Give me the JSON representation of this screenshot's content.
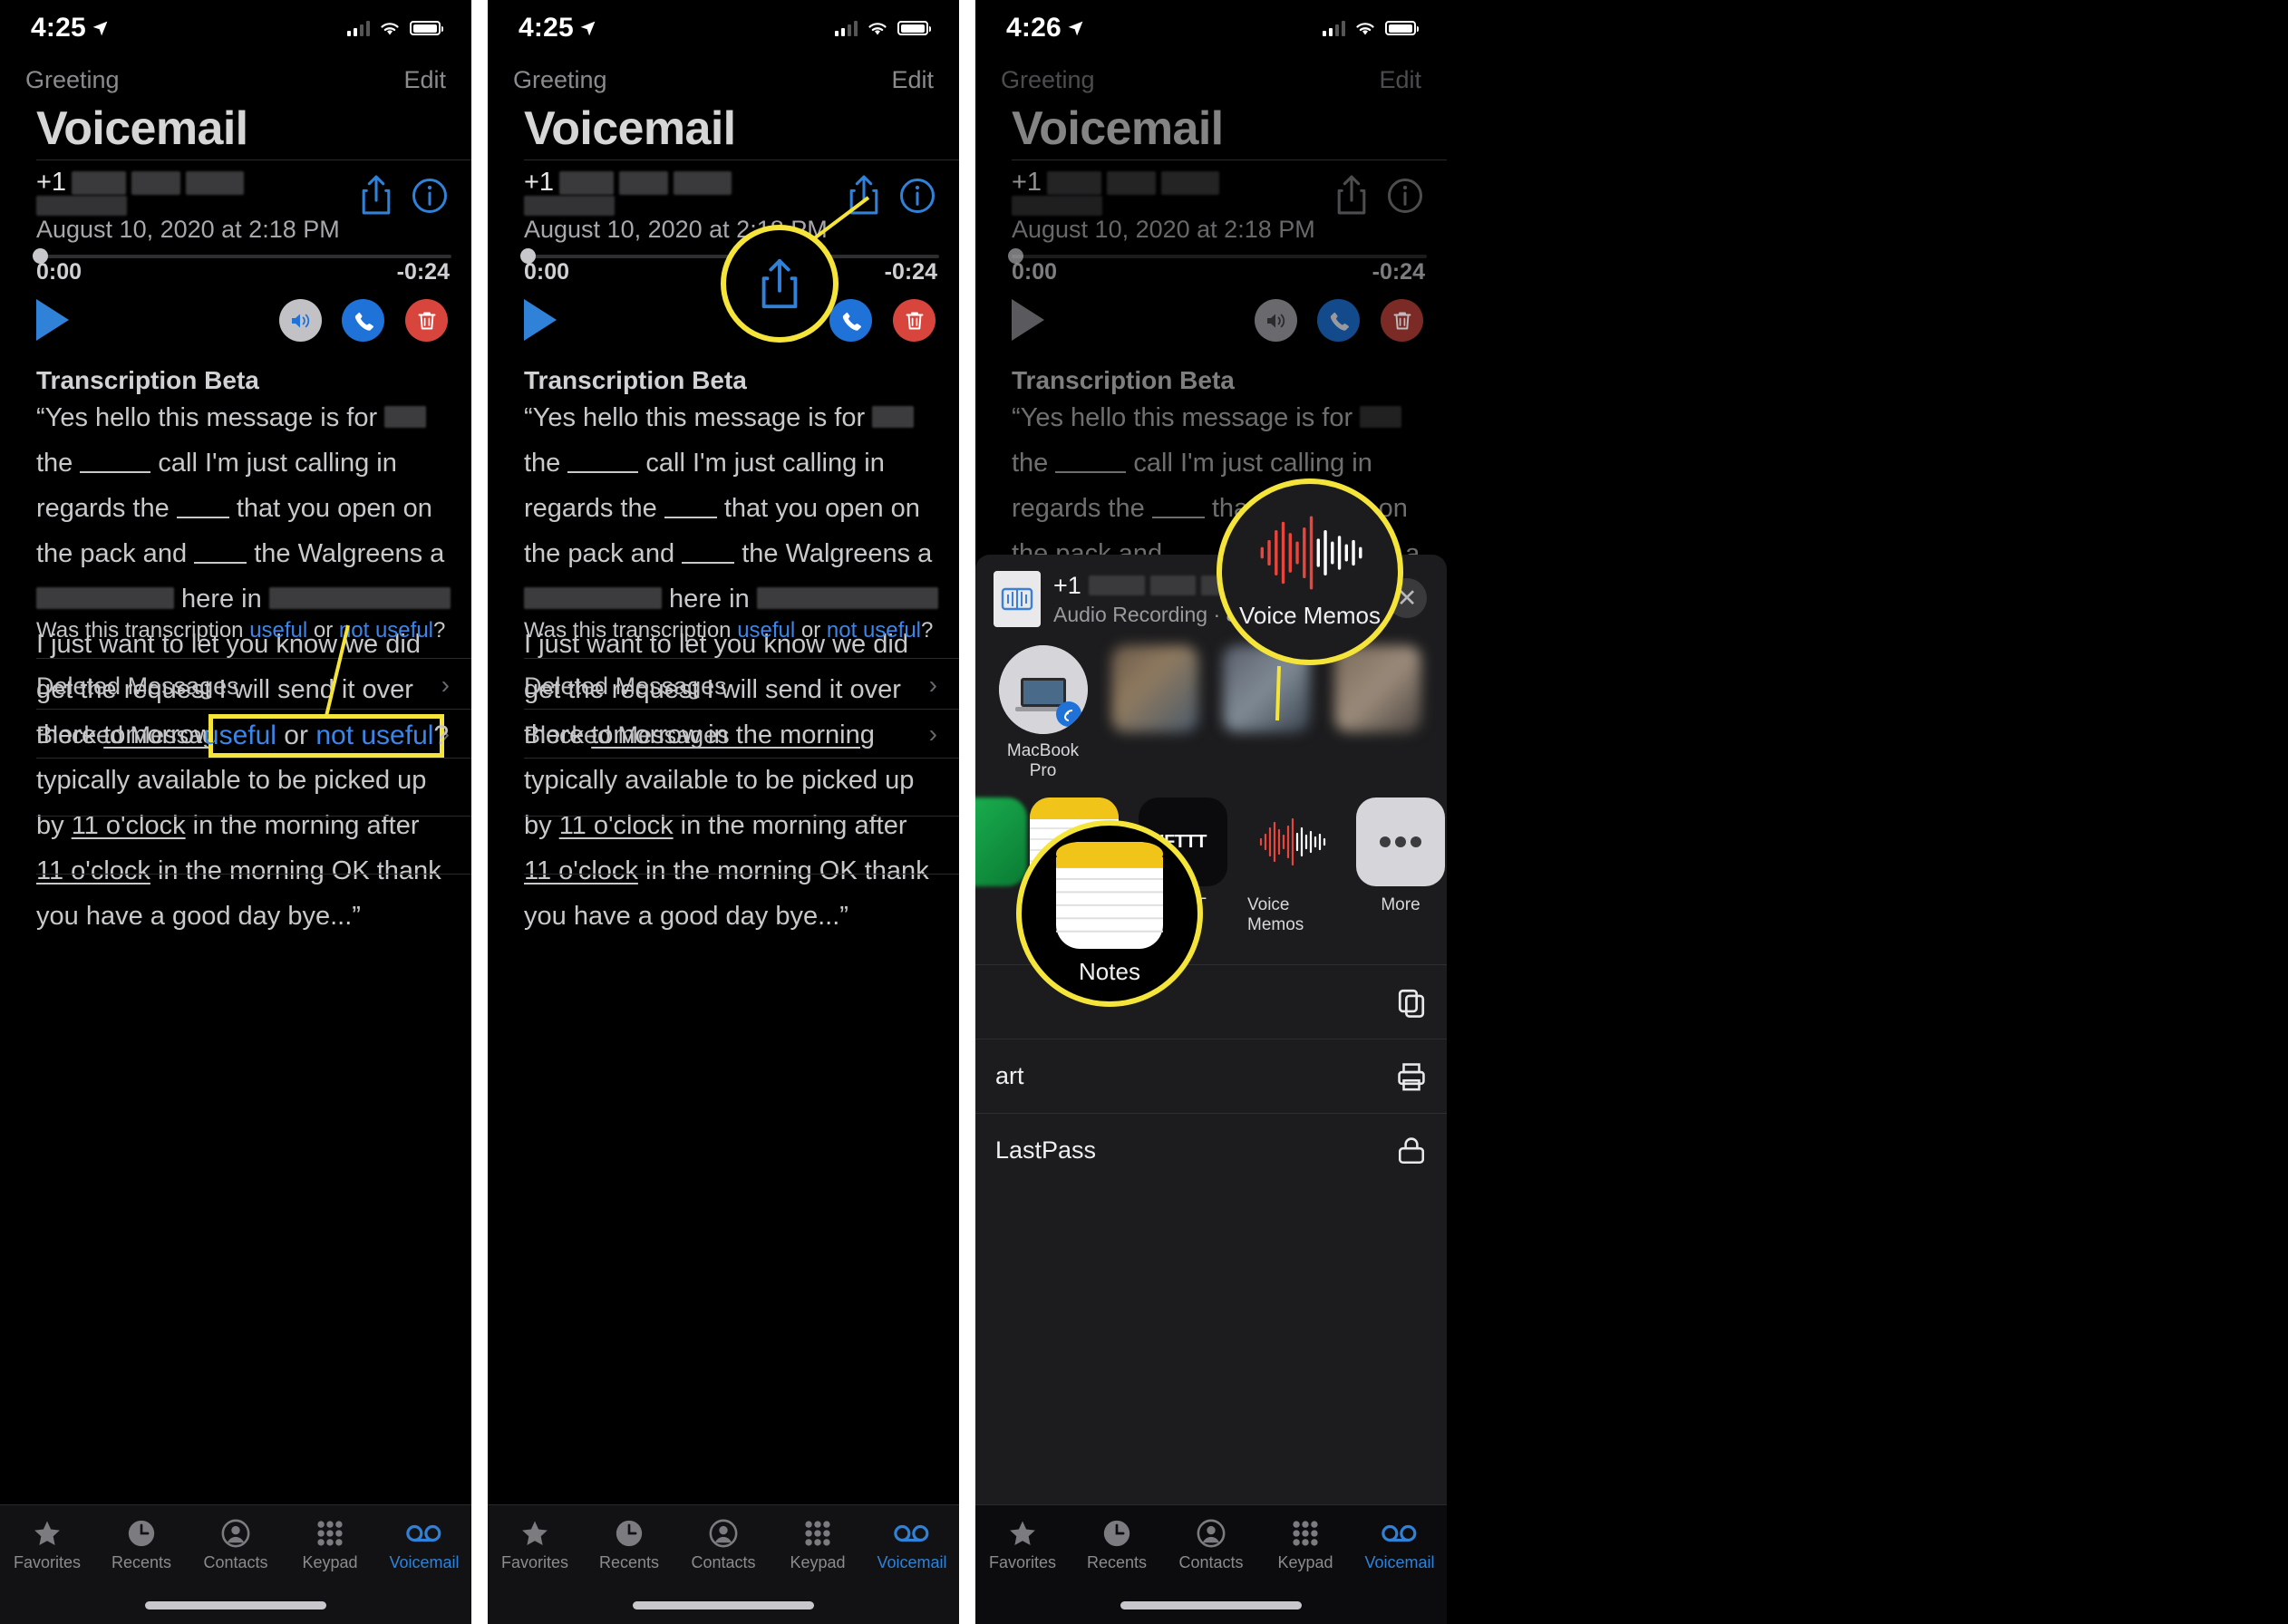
{
  "panels": [
    {
      "status": {
        "time": "4:25",
        "location_icon": "location-arrow-icon"
      },
      "nav": {
        "left": "Greeting",
        "right": "Edit"
      },
      "title": "Voicemail",
      "caller": {
        "prefix": "+1",
        "redacted": true
      },
      "timestamp": "August 10, 2020 at 2:18 PM",
      "player": {
        "elapsed": "0:00",
        "remaining": "-0:24",
        "progress": 0
      },
      "transcription": {
        "heading": "Transcription Beta",
        "text": "“Yes hello this message is for ___ the ______ call I'm just calling in regards the ____ that you open on the pack and ____ the Walgreens a ______ here in ________ I just want to let you know we did get the request I will send it over there tomorrow in the morning typically available to be picked up by 11 o'clock in the morning after 11 o'clock in the morning OK thank you have a good day bye...”",
        "feedback_prefix": "Was this transcription ",
        "feedback_useful": "useful",
        "feedback_or": " or ",
        "feedback_not_useful": "not useful",
        "feedback_suffix": "?"
      },
      "rows": [
        {
          "label": "Deleted Messages"
        },
        {
          "label": "Blocked Messages"
        }
      ],
      "tabs": [
        {
          "label": "Favorites",
          "icon": "star-icon",
          "active": false
        },
        {
          "label": "Recents",
          "icon": "clock-icon",
          "active": false
        },
        {
          "label": "Contacts",
          "icon": "person-circle-icon",
          "active": false
        },
        {
          "label": "Keypad",
          "icon": "keypad-icon",
          "active": false
        },
        {
          "label": "Voicemail",
          "icon": "voicemail-icon",
          "active": true
        }
      ],
      "callout": {
        "type": "box",
        "prefix": "useful",
        "middle": " or ",
        "suffix": "not useful",
        "tail": "?",
        "color": "#f5e53a"
      }
    },
    {
      "status": {
        "time": "4:25",
        "location_icon": "location-arrow-icon"
      },
      "nav": {
        "left": "Greeting",
        "right": "Edit"
      },
      "title": "Voicemail",
      "caller": {
        "prefix": "+1",
        "redacted": true
      },
      "timestamp": "August 10, 2020 at 2:18 PM",
      "player": {
        "elapsed": "0:00",
        "remaining": "-0:24",
        "progress": 0
      },
      "transcription": {
        "heading": "Transcription Beta",
        "feedback_prefix": "Was this transcription ",
        "feedback_useful": "useful",
        "feedback_or": " or ",
        "feedback_not_useful": "not useful",
        "feedback_suffix": "?"
      },
      "rows": [
        {
          "label": "Deleted Messages"
        },
        {
          "label": "Blocked Messages"
        }
      ],
      "tabs": [
        {
          "label": "Favorites",
          "icon": "star-icon",
          "active": false
        },
        {
          "label": "Recents",
          "icon": "clock-icon",
          "active": false
        },
        {
          "label": "Contacts",
          "icon": "person-circle-icon",
          "active": false
        },
        {
          "label": "Keypad",
          "icon": "keypad-icon",
          "active": false
        },
        {
          "label": "Voicemail",
          "icon": "voicemail-icon",
          "active": true
        }
      ],
      "callout": {
        "type": "circle",
        "target": "share-icon",
        "color": "#f5e53a"
      }
    },
    {
      "status": {
        "time": "4:26",
        "location_icon": "location-arrow-icon"
      },
      "nav": {
        "left": "Greeting",
        "right": "Edit"
      },
      "title": "Voicemail",
      "caller": {
        "prefix": "+1",
        "redacted": true
      },
      "timestamp": "August 10, 2020 at 2:18 PM",
      "player": {
        "elapsed": "0:00",
        "remaining": "-0:24",
        "progress": 0
      },
      "transcription": {
        "heading": "Transcription Beta"
      },
      "share_sheet": {
        "header": {
          "title_prefix": "+1",
          "subtitle": "Audio Recording · 8/10",
          "close_label": "✕",
          "doc_icon": "audio-file-icon"
        },
        "airdrop": [
          {
            "label": "MacBook Pro",
            "icon": "macbook-icon"
          },
          {
            "label": "",
            "icon": "blurred-contact"
          },
          {
            "label": "",
            "icon": "blurred-contact"
          },
          {
            "label": "",
            "icon": "blurred-contact"
          }
        ],
        "apps": [
          {
            "label": "",
            "icon": "blurred-app"
          },
          {
            "label": "Notes",
            "icon": "notes-icon"
          },
          {
            "label": "IFTTT",
            "icon": "ifttt-icon"
          },
          {
            "label": "Voice Memos",
            "icon": "voice-memos-icon"
          },
          {
            "label": "More",
            "icon": "more-icon"
          }
        ],
        "actions": [
          {
            "label": "",
            "icon": "copy-icon"
          },
          {
            "label": "art",
            "icon": "print-icon"
          },
          {
            "label": "LastPass",
            "icon": "lastpass-icon"
          }
        ]
      },
      "callouts": [
        {
          "type": "circle",
          "label": "Voice Memos",
          "color": "#f5e53a"
        },
        {
          "type": "circle",
          "label": "Notes",
          "color": "#f5e53a"
        }
      ],
      "tabs": [
        {
          "label": "Favorites",
          "icon": "star-icon",
          "active": false
        },
        {
          "label": "Recents",
          "icon": "clock-icon",
          "active": false
        },
        {
          "label": "Contacts",
          "icon": "person-circle-icon",
          "active": false
        },
        {
          "label": "Keypad",
          "icon": "keypad-icon",
          "active": false
        },
        {
          "label": "Voicemail",
          "icon": "voicemail-icon",
          "active": true
        }
      ]
    }
  ],
  "colors": {
    "accent_blue": "#2f82d8",
    "link_blue": "#3b86e8",
    "highlight_yellow": "#f5e53a",
    "delete_red": "#d8453c",
    "background": "#000000"
  }
}
